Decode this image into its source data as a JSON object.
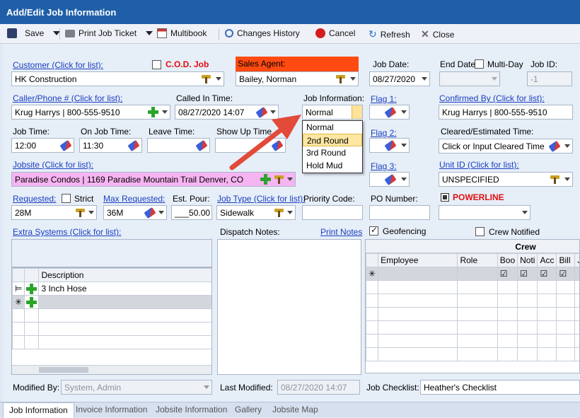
{
  "window": {
    "title": "Add/Edit Job Information"
  },
  "toolbar": {
    "save": "Save",
    "print": "Print Job Ticket",
    "multibook": "Multibook",
    "history": "Changes History",
    "cancel": "Cancel",
    "refresh": "Refresh",
    "close": "Close"
  },
  "customer": {
    "label": "Customer (Click for list):",
    "value": "HK Construction",
    "cod_label": "C.O.D. Job"
  },
  "sales_agent": {
    "label": "Sales Agent:",
    "value": "Bailey, Norman"
  },
  "job_date": {
    "label": "Job Date:",
    "value": "08/27/2020"
  },
  "end_date": {
    "label": "End Date:",
    "multiday_label": "Multi-Day"
  },
  "job_id": {
    "label": "Job ID:",
    "value": "-1"
  },
  "caller": {
    "label": "Caller/Phone # (Click for list):",
    "value": "Krug Harrys | 800-555-9510"
  },
  "called_in": {
    "label": "Called In Time:",
    "value": "08/27/2020 14:07"
  },
  "job_info": {
    "label": "Job Information:",
    "value": "Normal",
    "options": [
      "Normal",
      "2nd Round",
      "3rd Round",
      "Hold Mud"
    ],
    "selected_option": "2nd Round"
  },
  "flags": {
    "flag1": "Flag 1:",
    "flag2": "Flag 2:",
    "flag3": "Flag 3:"
  },
  "confirmed_by": {
    "label": "Confirmed By (Click for list):",
    "value": "Krug Harrys | 800-555-9510"
  },
  "times": {
    "job_time_label": "Job Time:",
    "job_time": "12:00",
    "on_job_label": "On Job Time:",
    "on_job": "11:30",
    "leave_label": "Leave Time:",
    "show_up_label": "Show Up Time"
  },
  "cleared": {
    "label": "Cleared/Estimated Time:",
    "value": "Click or Input Cleared Time"
  },
  "jobsite": {
    "label": "Jobsite (Click for list):",
    "value": "Paradise Condos | 1169 Paradise Mountain Trail Denver, CO"
  },
  "unit": {
    "label": "Unit ID (Click for list):",
    "value": "UNSPECIFIED"
  },
  "requested": {
    "label": "Requested:",
    "strict_label": "Strict",
    "value": "28M"
  },
  "max_requested": {
    "label": "Max Requested:",
    "value": "36M"
  },
  "est_pour": {
    "label": "Est. Pour:",
    "value": "___50.00"
  },
  "job_type": {
    "label": "Job Type (Click for list):",
    "value": "Sidewalk"
  },
  "priority": {
    "label": "Priority Code:"
  },
  "po": {
    "label": "PO Number:"
  },
  "powerline": {
    "label": "POWERLINE"
  },
  "extra_systems": {
    "label": "Extra Systems (Click for list):",
    "col_description": "Description",
    "row1": "3 Inch Hose"
  },
  "dispatch": {
    "label": "Dispatch Notes:",
    "print_link": "Print Notes"
  },
  "geofencing": {
    "label": "Geofencing"
  },
  "crew_notified": {
    "label": "Crew Notified"
  },
  "crew": {
    "title": "Crew",
    "columns": [
      "Employee",
      "Role",
      "Boo",
      "Noti",
      "Acc",
      "Bill",
      "Jo"
    ]
  },
  "footer": {
    "modified_by_label": "Modified By:",
    "modified_by": "System, Admin",
    "last_modified_label": "Last Modified:",
    "last_modified": "08/27/2020 14:07",
    "checklist_label": "Job Checklist:",
    "checklist": "Heather's Checklist"
  },
  "tabs": [
    "Job Information",
    "Invoice Information",
    "Jobsite Information",
    "Gallery",
    "Jobsite Map"
  ],
  "colors": {
    "title_bar": "#1f5fa8",
    "sales_agent_bg": "#ff4a12",
    "cod_red": "#e01010",
    "jobsite_bg": "#f7b4f2",
    "arrow": "#e24a3a"
  }
}
